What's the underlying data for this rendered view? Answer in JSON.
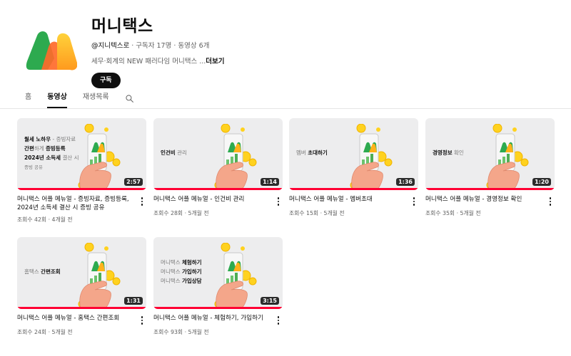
{
  "channel": {
    "name": "머니택스",
    "handle": "@지니텍스로",
    "subscribers": "구독자 17명",
    "videos": "동영상 6개",
    "description": "세무·회계의 NEW 패러다임 머니택스 ...",
    "more_label": "더보기",
    "subscribe_label": "구독",
    "meta_separator": " · "
  },
  "tabs": [
    {
      "label": "홈",
      "active": false
    },
    {
      "label": "동영상",
      "active": true
    },
    {
      "label": "재생목록",
      "active": false
    }
  ],
  "colors": {
    "accent_progress": "#ff0033",
    "logo_green": "#2daa4f",
    "logo_orange": "#ff7a2a",
    "logo_yellow": "#ffc21a",
    "coin": "#ffd21f",
    "hand": "#f4a68a"
  },
  "icons": {
    "tab_search": "search-icon",
    "card_menu": "more-vert-icon",
    "channel_logo": "money-tax-logo"
  },
  "videos": [
    {
      "title": "머니택스 어플 메뉴얼 - 증빙자료, 증빙등록, 2024년 소득세 결산 시 증빙 공유",
      "views": "조회수 42회",
      "age": "4개월 전",
      "duration": "2:57",
      "watched_fraction": 1.0,
      "thumb_lines": [
        {
          "bold": "월세 노하우",
          "light": " - 증빙자료"
        },
        {
          "bold": "간편",
          "light": "하게 ",
          "bold2": "증빙등록"
        },
        {
          "bold": "2024년 소득세",
          "light": " 결산 시"
        },
        {
          "small": "증빙 공유"
        }
      ]
    },
    {
      "title": "머니택스 어플 메뉴얼 - 인건비 관리",
      "views": "조회수 28회",
      "age": "5개월 전",
      "duration": "1:14",
      "watched_fraction": 1.0,
      "thumb_lines": [
        {
          "bold": "인건비",
          "light": " 관리"
        }
      ]
    },
    {
      "title": "머니택스 어플 메뉴얼 - 멤버초대",
      "views": "조회수 15회",
      "age": "5개월 전",
      "duration": "1:36",
      "watched_fraction": 1.0,
      "thumb_lines": [
        {
          "light": "멤버 ",
          "bold": "초대하기"
        }
      ]
    },
    {
      "title": "머니택스 어플 메뉴얼 - 경영정보 확인",
      "views": "조회수 35회",
      "age": "5개월 전",
      "duration": "1:20",
      "watched_fraction": 1.0,
      "thumb_lines": [
        {
          "bold": "경영정보",
          "light": " 확인"
        }
      ]
    },
    {
      "title": "머니택스 어플 메뉴얼 - 홈택스 간편조회",
      "views": "조회수 24회",
      "age": "5개월 전",
      "duration": "1:31",
      "watched_fraction": 1.0,
      "thumb_lines": [
        {
          "light": "홈택스 ",
          "bold": "간편조회"
        }
      ]
    },
    {
      "title": "머니택스 어플 메뉴얼 - 체험하기, 가입하기",
      "views": "조회수 93회",
      "age": "5개월 전",
      "duration": "3:15",
      "watched_fraction": 1.0,
      "thumb_lines": [
        {
          "light": "머니택스 ",
          "bold": "체험하기"
        },
        {
          "light": "머니택스 ",
          "bold": "가입하기"
        },
        {
          "light": "머니택스 ",
          "bold": "가입상담"
        }
      ]
    }
  ]
}
